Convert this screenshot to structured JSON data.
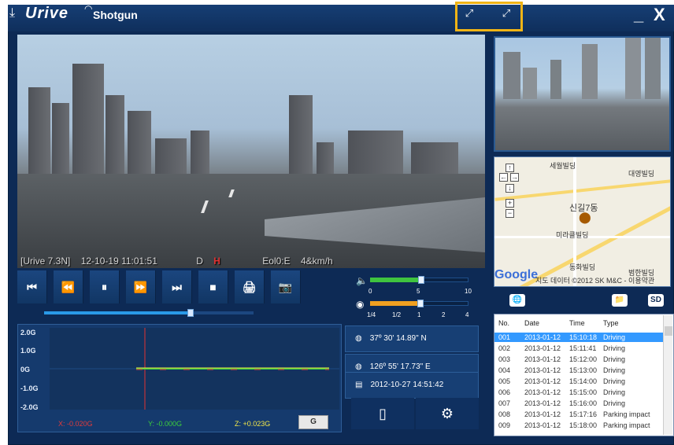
{
  "titlebar": {
    "brand": "Urive",
    "product": "Shotgun",
    "expand_left_icon": "expand-arrows-icon",
    "expand_right_icon": "expand-arrows-icon",
    "min": "_",
    "close": "X"
  },
  "video": {
    "overlay_model": "[Urive 7.3N]",
    "overlay_datetime": "12-10-19 11:01:51",
    "overlay_d": "D",
    "overlay_h": "H",
    "overlay_speed_label": "Eol0:E",
    "overlay_speed": "4&km/h"
  },
  "controls": {
    "buttons": [
      "⏮",
      "⏪",
      "⏸",
      "⏩",
      "⏭",
      "■",
      "🖨",
      "📷"
    ],
    "progress": 0.7,
    "volume": {
      "icon": "speaker-icon",
      "level": 0.52,
      "ticks": [
        "0",
        "5",
        "10"
      ]
    },
    "speed": {
      "icon": "speed-icon",
      "level": 0.51,
      "ticks": [
        "1/4",
        "1/2",
        "1",
        "2",
        "4"
      ]
    }
  },
  "gsensor": {
    "yticks": [
      "2.0G",
      "1.0G",
      "0G",
      "-1.0G",
      "-2.0G"
    ],
    "x_label": "X: -0.020G",
    "y_label": "Y: -0.000G",
    "z_label": "Z: +0.023G",
    "button": "G",
    "colors": {
      "x": "#e23b3b",
      "y": "#3ccf3c",
      "z": "#f3e84a"
    }
  },
  "gps": {
    "lat": "37º 30' 14.89\" N",
    "lon": "126º 55' 17.73\" E",
    "datetime": "2012-10-27 14:51:42"
  },
  "map": {
    "labels": [
      "세월빌딩",
      "대영빌딩",
      "신길7동",
      "미라클빌딩",
      "동화빌딩",
      "범한빌딩"
    ],
    "google": "Google",
    "credit": "지도 데이터 ©2012 SK M&C - 이용약관"
  },
  "tabs": {
    "left": "🌐",
    "right1": "📁",
    "right2": "SD"
  },
  "events": {
    "headers": [
      "No.",
      "Date",
      "Time",
      "Type"
    ],
    "rows": [
      {
        "no": "001",
        "date": "2013-01-12",
        "time": "15:10:18",
        "type": "Driving",
        "selected": true
      },
      {
        "no": "002",
        "date": "2013-01-12",
        "time": "15:11:41",
        "type": "Driving"
      },
      {
        "no": "003",
        "date": "2013-01-12",
        "time": "15:12:00",
        "type": "Driving"
      },
      {
        "no": "004",
        "date": "2013-01-12",
        "time": "15:13:00",
        "type": "Driving"
      },
      {
        "no": "005",
        "date": "2013-01-12",
        "time": "15:14:00",
        "type": "Driving"
      },
      {
        "no": "006",
        "date": "2013-01-12",
        "time": "15:15:00",
        "type": "Driving"
      },
      {
        "no": "007",
        "date": "2013-01-12",
        "time": "15:16:00",
        "type": "Driving"
      },
      {
        "no": "008",
        "date": "2013-01-12",
        "time": "15:17:16",
        "type": "Parking impact"
      },
      {
        "no": "009",
        "date": "2013-01-12",
        "time": "15:18:00",
        "type": "Parking impact"
      }
    ]
  }
}
